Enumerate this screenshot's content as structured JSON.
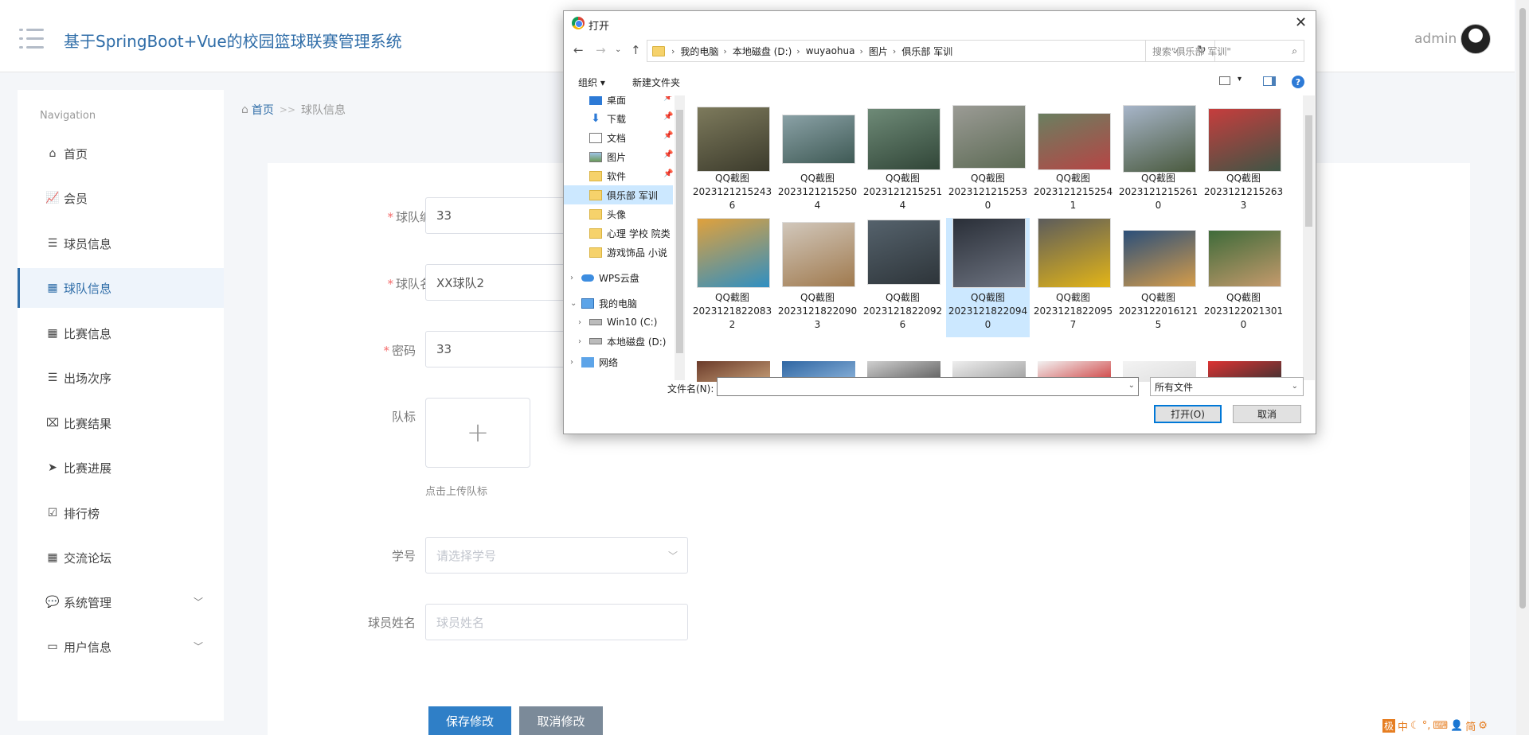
{
  "header": {
    "title": "基于SpringBoot+Vue的校园篮球联赛管理系统",
    "admin_label": "admin"
  },
  "sidebar": {
    "heading": "Navigation",
    "items": [
      {
        "label": "首页",
        "icon": "home-icon"
      },
      {
        "label": "会员",
        "icon": "chart-line-icon"
      },
      {
        "label": "球员信息",
        "icon": "list-icon"
      },
      {
        "label": "球队信息",
        "icon": "grid-icon",
        "active": true
      },
      {
        "label": "比赛信息",
        "icon": "grid-icon"
      },
      {
        "label": "出场次序",
        "icon": "list-icon"
      },
      {
        "label": "比赛结果",
        "icon": "clipboard-x-icon"
      },
      {
        "label": "比赛进展",
        "icon": "paper-plane-icon"
      },
      {
        "label": "排行榜",
        "icon": "clipboard-check-icon"
      },
      {
        "label": "交流论坛",
        "icon": "grid-icon"
      },
      {
        "label": "系统管理",
        "icon": "comment-icon",
        "expandable": true
      },
      {
        "label": "用户信息",
        "icon": "id-card-icon",
        "expandable": true
      }
    ]
  },
  "breadcrumb": {
    "home": "首页",
    "separator": ">>",
    "current": "球队信息"
  },
  "form": {
    "team_no": {
      "label": "球队编号",
      "value": "33"
    },
    "team_name": {
      "label": "球队名称",
      "value": "XX球队2"
    },
    "password": {
      "label": "密码",
      "value": "33"
    },
    "logo": {
      "label": "队标",
      "plus": "+",
      "tip": "点击上传队标"
    },
    "student_no": {
      "label": "学号",
      "placeholder": "请选择学号"
    },
    "player_name": {
      "label": "球员姓名",
      "placeholder": "球员姓名"
    },
    "save_label": "保存修改",
    "cancel_label": "取消修改"
  },
  "dialog": {
    "title": "打开",
    "close": "✕",
    "path": [
      "我的电脑",
      "本地磁盘 (D:)",
      "wuyaohua",
      "图片",
      "俱乐部 军训"
    ],
    "search_placeholder": "搜索\"俱乐部 军训\"",
    "toolbar": {
      "organize": "组织 ▾",
      "new_folder": "新建文件夹"
    },
    "tree": [
      {
        "label": "桌面",
        "icon": "desktop-icon",
        "pinned": true
      },
      {
        "label": "下载",
        "icon": "download-icon",
        "pinned": true
      },
      {
        "label": "文档",
        "icon": "document-icon",
        "pinned": true
      },
      {
        "label": "图片",
        "icon": "pictures-icon",
        "pinned": true
      },
      {
        "label": "软件",
        "icon": "folder-icon",
        "pinned": true
      },
      {
        "label": "俱乐部 军训",
        "icon": "folder-icon",
        "selected": true
      },
      {
        "label": "头像",
        "icon": "folder-icon"
      },
      {
        "label": "心理 学校 院类",
        "icon": "folder-icon"
      },
      {
        "label": "游戏饰品 小说",
        "icon": "folder-icon"
      },
      {
        "label": "WPS云盘",
        "icon": "cloud-icon"
      },
      {
        "label": "我的电脑",
        "icon": "computer-icon"
      },
      {
        "label": "Win10 (C:)",
        "icon": "drive-icon"
      },
      {
        "label": "本地磁盘 (D:)",
        "icon": "drive-icon"
      },
      {
        "label": "网络",
        "icon": "network-icon"
      }
    ],
    "files": [
      {
        "name": "QQ截图",
        "id": "20231212152436",
        "colors": [
          "#7d7a5c",
          "#3c3b2c"
        ]
      },
      {
        "name": "QQ截图",
        "id": "20231212152504",
        "colors": [
          "#8aa1a6",
          "#3f5a55"
        ]
      },
      {
        "name": "QQ截图",
        "id": "20231212152514",
        "colors": [
          "#6e8a77",
          "#314638"
        ]
      },
      {
        "name": "QQ截图",
        "id": "20231212152530",
        "colors": [
          "#9b9b95",
          "#5d6b55"
        ]
      },
      {
        "name": "QQ截图",
        "id": "20231212152541",
        "colors": [
          "#6a7f60",
          "#b64545"
        ]
      },
      {
        "name": "QQ截图",
        "id": "20231212152610",
        "colors": [
          "#a7b5c9",
          "#4a5a3e"
        ]
      },
      {
        "name": "QQ截图",
        "id": "20231212152633",
        "colors": [
          "#c63d3d",
          "#3f5545"
        ]
      },
      {
        "name": "QQ截图",
        "id": "20231218220832",
        "colors": [
          "#e0a13c",
          "#2f8fc2"
        ]
      },
      {
        "name": "QQ截图",
        "id": "20231218220903",
        "colors": [
          "#d1c7bb",
          "#a07a4e"
        ]
      },
      {
        "name": "QQ截图",
        "id": "20231218220926",
        "colors": [
          "#55626c",
          "#2e353a"
        ]
      },
      {
        "name": "QQ截图",
        "id": "20231218220940",
        "colors": [
          "#2a2f38",
          "#6d7380"
        ],
        "selected": true
      },
      {
        "name": "QQ截图",
        "id": "20231218220957",
        "colors": [
          "#5c5c5c",
          "#e3b517"
        ]
      },
      {
        "name": "QQ截图",
        "id": "20231220161215",
        "colors": [
          "#2b4f7a",
          "#d49c4a"
        ]
      },
      {
        "name": "QQ截图",
        "id": "20231220213010",
        "colors": [
          "#3f6b3a",
          "#c49a6c"
        ]
      }
    ],
    "filename_label": "文件名(N):",
    "filename_value": "",
    "filetype": "所有文件",
    "open_label": "打开(O)",
    "cancel_label": "取消"
  },
  "tray": [
    "中",
    "☾",
    "°,",
    "⌨",
    "👤",
    "简",
    "⚙"
  ],
  "tray_logo": "极"
}
